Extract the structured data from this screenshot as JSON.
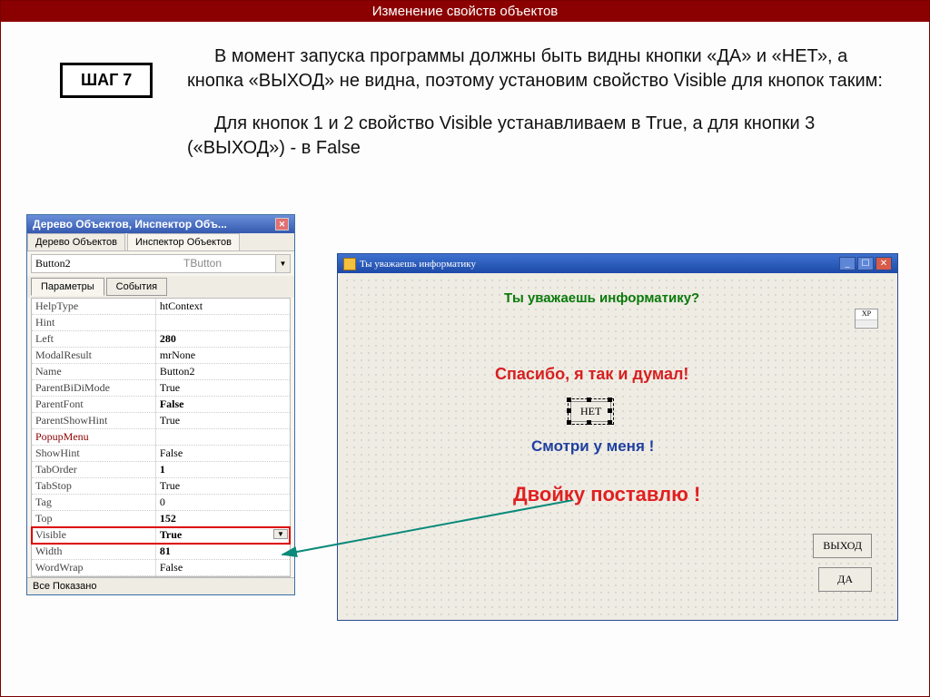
{
  "header": {
    "title": "Изменение свойств объектов"
  },
  "step": {
    "label": "ШАГ 7"
  },
  "text": {
    "p1": "В момент запуска программы должны быть видны кнопки «ДА» и «НЕТ», а кнопка «ВЫХОД» не видна, поэтому установим свойство Visible для кнопок таким:",
    "p2": "Для кнопок 1 и 2 свойство Visible устанавливаем в True, а для кнопки 3 («ВЫХОД») - в False"
  },
  "inspector": {
    "title": "Дерево Объектов, Инспектор Объ...",
    "tab_tree": "Дерево Объектов",
    "tab_insp": "Инспектор Объектов",
    "object_name": "Button2",
    "object_type": "TButton",
    "tab_props": "Параметры",
    "tab_events": "События",
    "props": [
      {
        "name": "HelpType",
        "value": "htContext",
        "bold": false
      },
      {
        "name": "Hint",
        "value": "",
        "bold": false
      },
      {
        "name": "Left",
        "value": "280",
        "bold": true
      },
      {
        "name": "ModalResult",
        "value": "mrNone",
        "bold": false
      },
      {
        "name": "Name",
        "value": "Button2",
        "bold": false
      },
      {
        "name": "ParentBiDiMode",
        "value": "True",
        "bold": false
      },
      {
        "name": "ParentFont",
        "value": "False",
        "bold": true
      },
      {
        "name": "ParentShowHint",
        "value": "True",
        "bold": false
      },
      {
        "name": "PopupMenu",
        "value": "",
        "bold": false,
        "namecolor": "darkred"
      },
      {
        "name": "ShowHint",
        "value": "False",
        "bold": false
      },
      {
        "name": "TabOrder",
        "value": "1",
        "bold": true
      },
      {
        "name": "TabStop",
        "value": "True",
        "bold": false
      },
      {
        "name": "Tag",
        "value": "0",
        "bold": false
      },
      {
        "name": "Top",
        "value": "152",
        "bold": true
      },
      {
        "name": "Visible",
        "value": "True",
        "bold": true,
        "selected": true
      },
      {
        "name": "Width",
        "value": "81",
        "bold": true
      },
      {
        "name": "WordWrap",
        "value": "False",
        "bold": false
      }
    ],
    "footer": "Все Показано"
  },
  "form": {
    "title": "Ты уважаешь информатику",
    "label_q": "Ты уважаешь информатику?",
    "label_thanks": "Спасибо, я так и думал!",
    "label_look": "Смотри у меня !",
    "label_two": "Двойку поставлю !",
    "btn_no": "НЕТ",
    "btn_exit": "ВЫХОД",
    "btn_yes": "ДА",
    "xp": "XP"
  }
}
